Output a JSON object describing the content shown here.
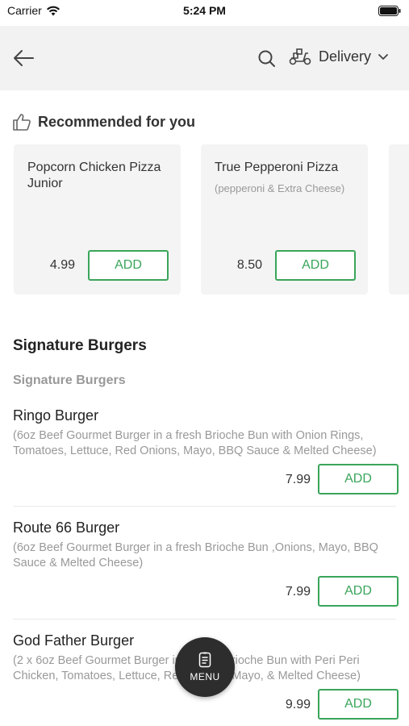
{
  "status_bar": {
    "carrier": "Carrier",
    "time": "5:24 PM"
  },
  "header": {
    "mode_label": "Delivery"
  },
  "recommended": {
    "title": "Recommended for you",
    "cards": [
      {
        "name": "Popcorn Chicken Pizza Junior",
        "description": "",
        "price": "4.99",
        "add_label": "ADD"
      },
      {
        "name": "True Pepperoni Pizza",
        "description": "(pepperoni & Extra Cheese)",
        "price": "8.50",
        "add_label": "ADD"
      }
    ]
  },
  "section": {
    "title": "Signature Burgers",
    "subtitle": "Signature Burgers",
    "items": [
      {
        "name": "Ringo Burger",
        "description": "(6oz Beef Gourmet Burger in a fresh Brioche Bun with Onion Rings, Tomatoes, Lettuce, Red Onions, Mayo, BBQ Sauce & Melted Cheese)",
        "price": "7.99",
        "add_label": "ADD"
      },
      {
        "name": "Route 66 Burger",
        "description": "(6oz Beef Gourmet Burger in a fresh Brioche  Bun ,Onions, Mayo, BBQ Sauce & Melted Cheese)",
        "price": "7.99",
        "add_label": "ADD"
      },
      {
        "name": "God Father Burger",
        "description": "(2 x 6oz Beef Gourmet Burger in a fresh Brioche Bun with Peri Peri Chicken, Tomatoes, Lettuce, Red Onions, Mayo, & Melted Cheese)",
        "price": "9.99",
        "add_label": "ADD"
      }
    ]
  },
  "menu_fab": {
    "label": "MENU"
  },
  "colors": {
    "accent": "#3aa55a",
    "header_bg": "#f2f2f2",
    "card_bg": "#f4f4f4",
    "fab_bg": "#2d2d2d"
  },
  "icons": [
    "wifi-icon",
    "battery-icon",
    "back-arrow-icon",
    "search-icon",
    "scooter-icon",
    "chevron-down-icon",
    "thumbs-up-icon",
    "menu-icon"
  ]
}
